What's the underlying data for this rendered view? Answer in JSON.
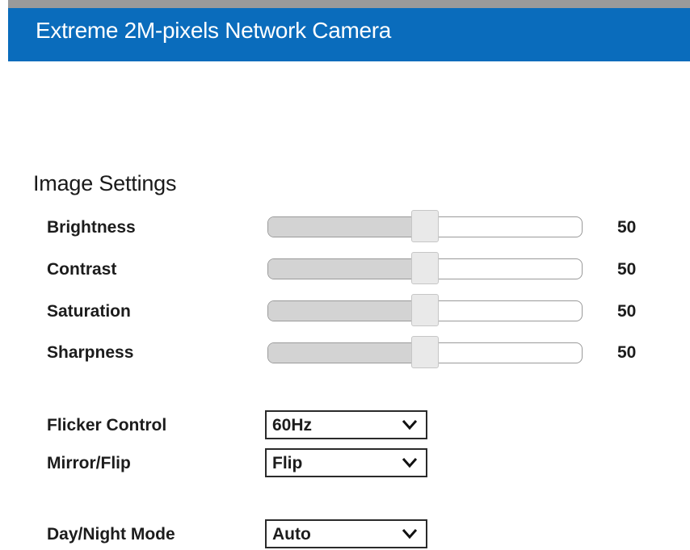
{
  "header": {
    "title": "Extreme 2M-pixels Network Camera"
  },
  "image_settings": {
    "title": "Image Settings",
    "sliders": [
      {
        "label": "Brightness",
        "value": "50",
        "level": 0.5
      },
      {
        "label": "Contrast",
        "value": "50",
        "level": 0.5
      },
      {
        "label": "Saturation",
        "value": "50",
        "level": 0.5
      },
      {
        "label": "Sharpness",
        "value": "50",
        "level": 0.5
      }
    ],
    "flicker_control": {
      "label": "Flicker Control",
      "selected": "60Hz"
    },
    "mirror_flip": {
      "label": "Mirror/Flip",
      "selected": "Flip"
    },
    "day_night_mode": {
      "label": "Day/Night Mode",
      "selected": "Auto"
    }
  },
  "icons": {
    "dropdown": "chevron-down-icon"
  },
  "colors": {
    "header_bg": "#0a6cbc",
    "header_text": "#ffffff",
    "slider_fill": "#d3d3d3"
  }
}
